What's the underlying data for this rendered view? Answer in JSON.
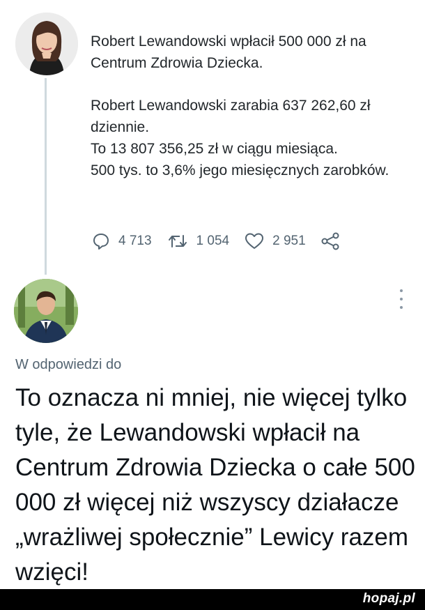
{
  "tweet": {
    "paragraph1": "Robert Lewandowski wpłacił 500 000 zł na Centrum Zdrowia Dziecka.",
    "paragraph2_line1": "Robert Lewandowski zarabia 637 262,60 zł dziennie.",
    "paragraph2_line2": "To 13 807 356,25 zł w ciągu miesiąca.",
    "paragraph2_line3": "500 tys. to 3,6% jego miesięcznych zarobków.",
    "replies": "4 713",
    "retweets": "1 054",
    "likes": "2 951"
  },
  "reply": {
    "reply_to_label": "W odpowiedzi do",
    "text": "To oznacza ni mniej, nie więcej tylko tyle, że Lewandowski wpłacił na Centrum Zdrowia Dziecka o całe 500 000 zł więcej niż wszyscy działacze „wrażliwej społecznie” Lewicy razem wzięci!"
  },
  "footer": {
    "watermark": "hopaj.pl"
  },
  "colors": {
    "muted": "#536471",
    "thread_line": "#cfd9de",
    "footer_bg": "#000000"
  }
}
